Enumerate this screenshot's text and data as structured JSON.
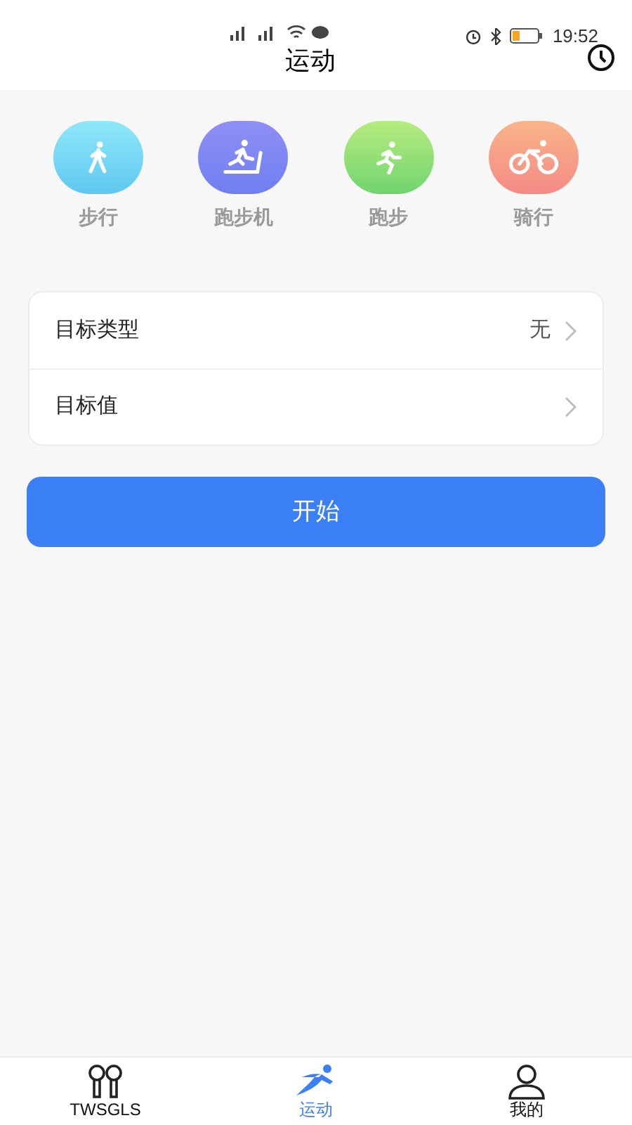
{
  "status_bar": {
    "time": "19:52"
  },
  "header": {
    "title": "运动"
  },
  "sports": [
    {
      "kind": "walk",
      "label": "步行"
    },
    {
      "kind": "treadmill",
      "label": "跑步机"
    },
    {
      "kind": "run",
      "label": "跑步"
    },
    {
      "kind": "cycle",
      "label": "骑行"
    }
  ],
  "settings": [
    {
      "label": "目标类型",
      "value": "无"
    },
    {
      "label": "目标值"
    }
  ],
  "start_button": "开始",
  "tabs": [
    {
      "kind": "earbuds",
      "label": "TWSGLS",
      "selected": false
    },
    {
      "kind": "sport",
      "label": "运动",
      "selected": true
    },
    {
      "kind": "person",
      "label": "我的",
      "selected": false
    }
  ]
}
